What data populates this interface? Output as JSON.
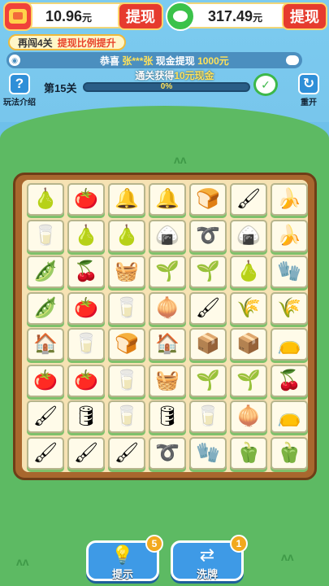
{
  "wallet": {
    "red_amount": "10.96",
    "red_unit": "元",
    "green_amount": "317.49",
    "green_unit": "元",
    "withdraw_label": "提现"
  },
  "tip": {
    "prefix": "再闯4关",
    "highlight": "提现比例提升"
  },
  "marquee": {
    "lead": "恭喜",
    "name": "张***张",
    "middle": "现金提现",
    "amount": "1000元"
  },
  "reward": {
    "prefix": "通关获得",
    "amount": "10元现金"
  },
  "level": {
    "label": "第15关",
    "progress_text": "0%",
    "progress_fraction": 0.0
  },
  "help": {
    "label": "玩法介绍",
    "icon": "question-icon"
  },
  "reset": {
    "label": "重开",
    "icon": "refresh-icon"
  },
  "board": {
    "rows": [
      [
        "pear",
        "persimmon",
        "bell",
        "bell",
        "bread",
        "brush",
        "banana"
      ],
      [
        "milk",
        "pear",
        "pear",
        "rice-dumpling",
        "hose",
        "rice-dumpling",
        "banana"
      ],
      [
        "pea-pod",
        "cherry",
        "basket",
        "sprout-pot",
        "sprout-pot",
        "pear",
        "glove"
      ],
      [
        "pea-pod",
        "persimmon",
        "milk",
        "onion",
        "brush",
        "wheat",
        "wheat"
      ],
      [
        "barn",
        "milk",
        "bread",
        "barn",
        "seed-packet",
        "seed-packet",
        "sack"
      ],
      [
        "persimmon",
        "persimmon",
        "milk",
        "basket",
        "sprout-pot",
        "sprout-pot",
        "cherry"
      ],
      [
        "brush",
        "barrel",
        "milk",
        "barrel",
        "milk",
        "onion",
        "sack"
      ],
      [
        "brush",
        "brush",
        "brush",
        "hose",
        "glove",
        "pepper",
        "pepper"
      ]
    ]
  },
  "buttons": {
    "hint": {
      "label": "提示",
      "badge": "5",
      "icon": "lightbulb-icon"
    },
    "shuffle": {
      "label": "洗牌",
      "badge": "1",
      "icon": "shuffle-icon"
    }
  }
}
